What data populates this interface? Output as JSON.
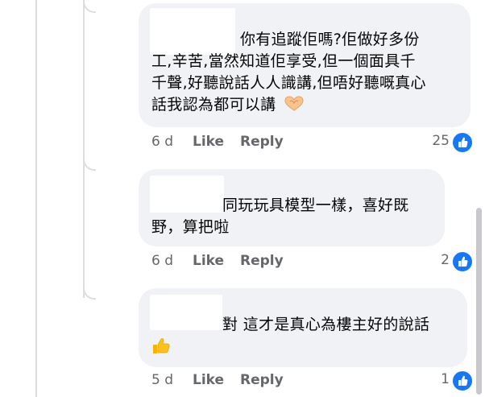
{
  "comments": [
    {
      "lines": [
        "你有追蹤佢嗎?佢做好多份",
        "工,辛苦,當然知道佢享受,但一個面具千",
        "千聲,好聽說話人人識講,但唔好聽嘅真心",
        "話我認為都可以講"
      ],
      "emoji": "heart-hands-icon",
      "time": "6 d",
      "like_label": "Like",
      "reply_label": "Reply",
      "reaction_count": "25"
    },
    {
      "lines": [
        "同玩玩具模型一樣，喜好既",
        "野，算把啦"
      ],
      "time": "6 d",
      "like_label": "Like",
      "reply_label": "Reply",
      "reaction_count": "2"
    },
    {
      "lines": [
        "對 這才是真心為樓主好的說話"
      ],
      "emoji": "thumbs-up-icon",
      "time": "5 d",
      "like_label": "Like",
      "reply_label": "Reply",
      "reaction_count": "1"
    }
  ],
  "colors": {
    "bubble": "#f0f2f5",
    "action_text": "#65676b",
    "like_blue": "#1877f2"
  }
}
